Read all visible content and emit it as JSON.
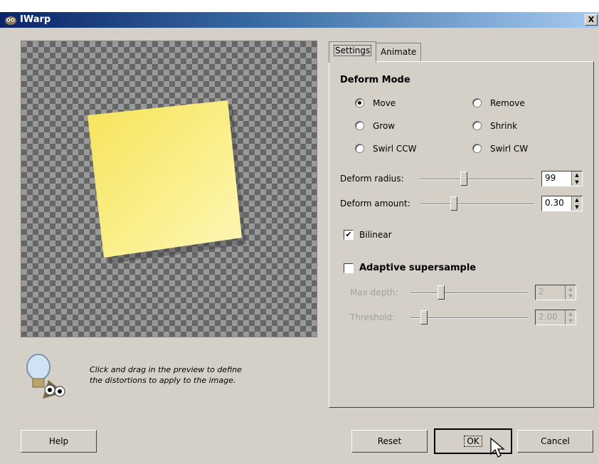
{
  "window": {
    "title": "IWarp",
    "close_label": "X"
  },
  "preview": {
    "hint_line1": "Click and drag in the preview to define",
    "hint_line2": "the distortions to apply to the image."
  },
  "tabs": [
    {
      "label": "Settings",
      "active": true
    },
    {
      "label": "Animate",
      "active": false
    }
  ],
  "deform_mode": {
    "title": "Deform Mode",
    "options": [
      {
        "label": "Move",
        "selected": true
      },
      {
        "label": "Remove",
        "selected": false
      },
      {
        "label": "Grow",
        "selected": false
      },
      {
        "label": "Shrink",
        "selected": false
      },
      {
        "label": "Swirl CCW",
        "selected": false
      },
      {
        "label": "Swirl CW",
        "selected": false
      }
    ]
  },
  "sliders": {
    "deform_radius": {
      "label": "Deform radius:",
      "value": "99"
    },
    "deform_amount": {
      "label": "Deform amount:",
      "value": "0.30"
    }
  },
  "bilinear": {
    "label": "Bilinear",
    "checked": true
  },
  "adaptive": {
    "label": "Adaptive supersample",
    "checked": false,
    "max_depth": {
      "label": "Max depth:",
      "value": "2"
    },
    "threshold": {
      "label": "Threshold:",
      "value": "2.00"
    }
  },
  "buttons": {
    "help": "Help",
    "reset": "Reset",
    "ok": "OK",
    "cancel": "Cancel"
  }
}
